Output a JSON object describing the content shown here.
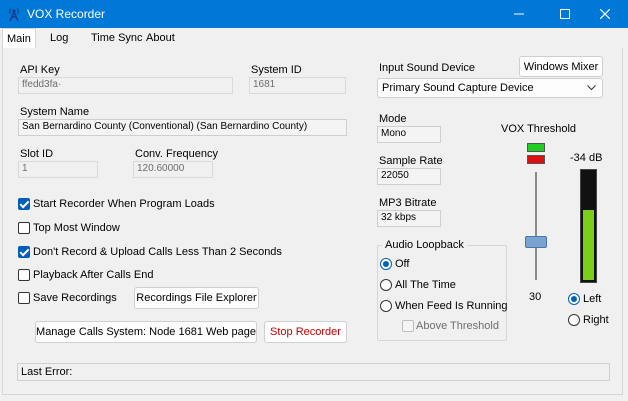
{
  "window": {
    "title": "VOX Recorder"
  },
  "tabs": [
    "Main",
    "Log",
    "Time Sync",
    "About"
  ],
  "main": {
    "api_key_label": "API Key",
    "api_key_value": "ffedd3fa·",
    "system_id_label": "System ID",
    "system_id_value": "1681",
    "system_name_label": "System Name",
    "system_name_value": "San Bernardino County (Conventional) (San Bernardino County)",
    "slot_id_label": "Slot ID",
    "slot_id_value": "1",
    "conv_freq_label": "Conv. Frequency",
    "conv_freq_value": "120.60000",
    "checkboxes": [
      {
        "label": "Start Recorder When Program Loads",
        "checked": true
      },
      {
        "label": "Top Most Window",
        "checked": false
      },
      {
        "label": "Don't Record & Upload Calls Less Than 2 Seconds",
        "checked": true
      },
      {
        "label": "Playback After Calls End",
        "checked": false
      },
      {
        "label": "Save Recordings",
        "checked": false
      }
    ],
    "recordings_explorer_btn": "Recordings File Explorer",
    "manage_calls_btn": "Manage Calls System: Node 1681 Web page",
    "stop_recorder_btn": "Stop Recorder",
    "last_error_label": "Last Error:"
  },
  "audio": {
    "input_device_label": "Input Sound Device",
    "windows_mixer_btn": "Windows Mixer",
    "input_device_value": "Primary Sound Capture Device",
    "mode_label": "Mode",
    "mode_value": "Mono",
    "sample_rate_label": "Sample Rate",
    "sample_rate_value": "22050",
    "mp3_bitrate_label": "MP3 Bitrate",
    "mp3_bitrate_value": "32 kbps",
    "loopback_title": "Audio Loopback",
    "loopback_options": [
      {
        "label": "Off",
        "selected": true
      },
      {
        "label": "All The Time",
        "selected": false
      },
      {
        "label": "When Feed Is Running",
        "selected": false
      }
    ],
    "above_threshold_label": "Above Threshold",
    "above_threshold_checked": false
  },
  "vox": {
    "title": "VOX Threshold",
    "db_value": "-34 dB",
    "threshold_value": "30",
    "threshold_fraction": 0.3,
    "meter_level_fraction": 0.65,
    "channel_options": [
      {
        "label": "Left",
        "selected": true
      },
      {
        "label": "Right",
        "selected": false
      }
    ],
    "indicator_colors": {
      "top": "#22cc22",
      "bottom": "#dd1111"
    },
    "meter_color": "#7ccf18"
  },
  "colors": {
    "titlebar": "#0078d7",
    "accent": "#005fb8"
  }
}
